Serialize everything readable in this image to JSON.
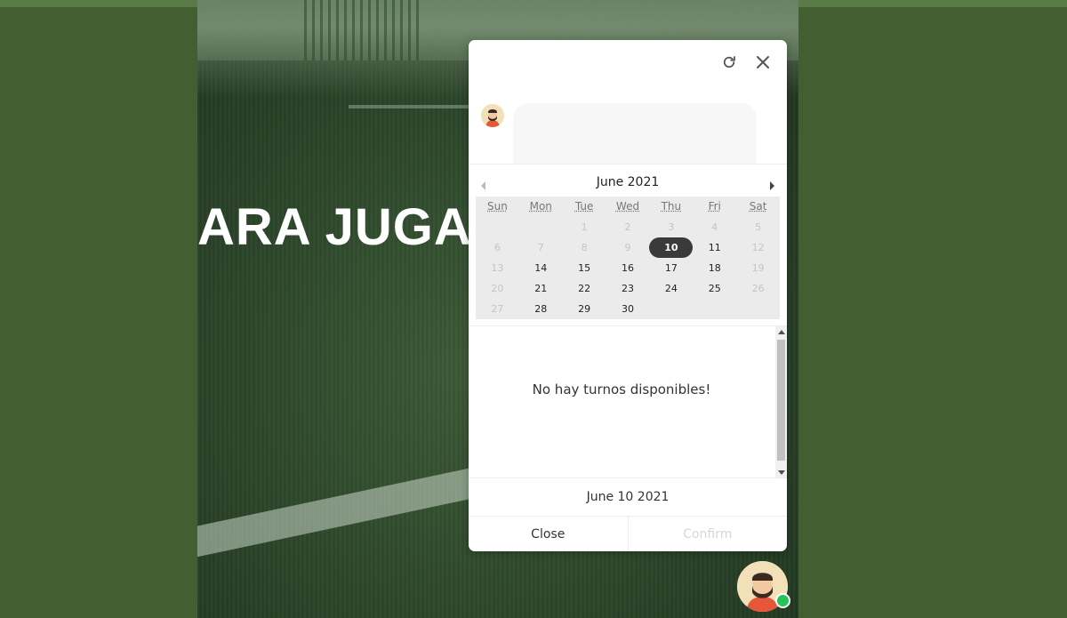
{
  "hero": {
    "title": "ARA JUGAR"
  },
  "colors": {
    "page_background": "#435e30",
    "panel_background": "#ffffff",
    "selected_day": "#3a3a3a",
    "online_status": "#27c25a",
    "confirm_disabled": "#d6d6d6"
  },
  "widget": {
    "icons": [
      "refresh-icon",
      "close-icon",
      "bot-avatar-icon",
      "chevron-left-icon",
      "chevron-right-icon"
    ],
    "calendar": {
      "month_label": "June 2021",
      "weekdays": [
        "Sun",
        "Mon",
        "Tue",
        "Wed",
        "Thu",
        "Fri",
        "Sat"
      ],
      "weeks": [
        [
          {
            "d": "",
            "off": true
          },
          {
            "d": "",
            "off": true
          },
          {
            "d": "1",
            "off": true
          },
          {
            "d": "2",
            "off": true
          },
          {
            "d": "3",
            "off": true
          },
          {
            "d": "4",
            "off": true
          },
          {
            "d": "5",
            "off": true
          }
        ],
        [
          {
            "d": "6",
            "off": true
          },
          {
            "d": "7",
            "off": true
          },
          {
            "d": "8",
            "off": true
          },
          {
            "d": "9",
            "off": true
          },
          {
            "d": "10",
            "off": false,
            "sel": true
          },
          {
            "d": "11",
            "off": false
          },
          {
            "d": "12",
            "off": true
          }
        ],
        [
          {
            "d": "13",
            "off": true
          },
          {
            "d": "14",
            "off": false
          },
          {
            "d": "15",
            "off": false
          },
          {
            "d": "16",
            "off": false
          },
          {
            "d": "17",
            "off": false
          },
          {
            "d": "18",
            "off": false
          },
          {
            "d": "19",
            "off": true
          }
        ],
        [
          {
            "d": "20",
            "off": true
          },
          {
            "d": "21",
            "off": false
          },
          {
            "d": "22",
            "off": false
          },
          {
            "d": "23",
            "off": false
          },
          {
            "d": "24",
            "off": false
          },
          {
            "d": "25",
            "off": false
          },
          {
            "d": "26",
            "off": true
          }
        ],
        [
          {
            "d": "27",
            "off": true
          },
          {
            "d": "28",
            "off": false
          },
          {
            "d": "29",
            "off": false
          },
          {
            "d": "30",
            "off": false
          },
          {
            "d": "",
            "off": true
          },
          {
            "d": "",
            "off": true
          },
          {
            "d": "",
            "off": true
          }
        ]
      ]
    },
    "slots_message": "No hay turnos disponibles!",
    "selected_date": "June 10 2021",
    "buttons": {
      "close": "Close",
      "confirm": "Confirm"
    }
  }
}
